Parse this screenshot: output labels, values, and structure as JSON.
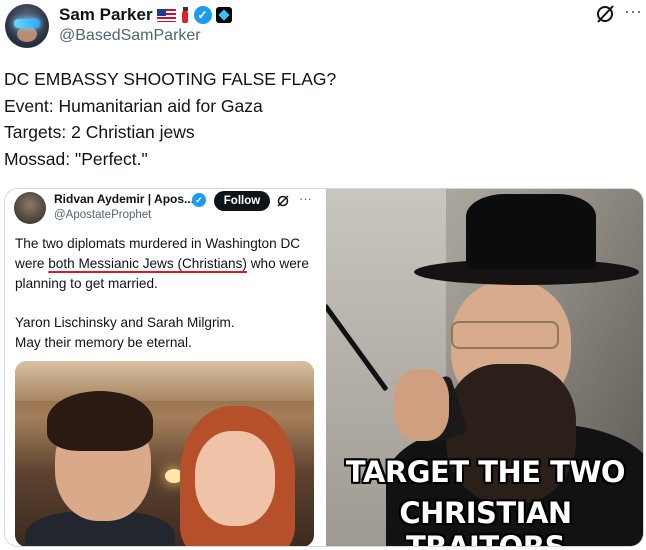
{
  "author": {
    "display_name": "Sam Parker",
    "handle": "@BasedSamParker",
    "badges": [
      "us-flag-icon",
      "fire-extinguisher-icon",
      "verified-badge-icon",
      "affiliate-badge-icon"
    ]
  },
  "header_icons": [
    "grok-icon",
    "more-options-icon"
  ],
  "tweet": {
    "lines": [
      "DC EMBASSY SHOOTING FALSE FLAG?",
      "Event: Humanitarian aid for Gaza",
      "Targets: 2 Christian jews",
      "Mossad: \"Perfect.\""
    ]
  },
  "quoted": {
    "display_name": "Ridvan Aydemir | Apos...",
    "handle": "@ApostateProphet",
    "follow_label": "Follow",
    "more_label": "···",
    "text": {
      "line1": "The two diplomats murdered in Washington DC",
      "line2_pre": "were ",
      "line2_underlined": "both Messianic Jews (Christians)",
      "line2_post": " who were",
      "line3": "planning to get married.",
      "line4": "Yaron Lischinsky and Sarah Milgrim.",
      "line5": "May their memory be eternal."
    }
  },
  "meme": {
    "caption_line1": "TARGET THE TWO",
    "caption_line2": "CHRISTIAN TRAITORS"
  },
  "colors": {
    "verified": "#1d9bf0",
    "text_primary": "#0f1419",
    "text_secondary": "#536471",
    "underline": "#e0191f"
  }
}
